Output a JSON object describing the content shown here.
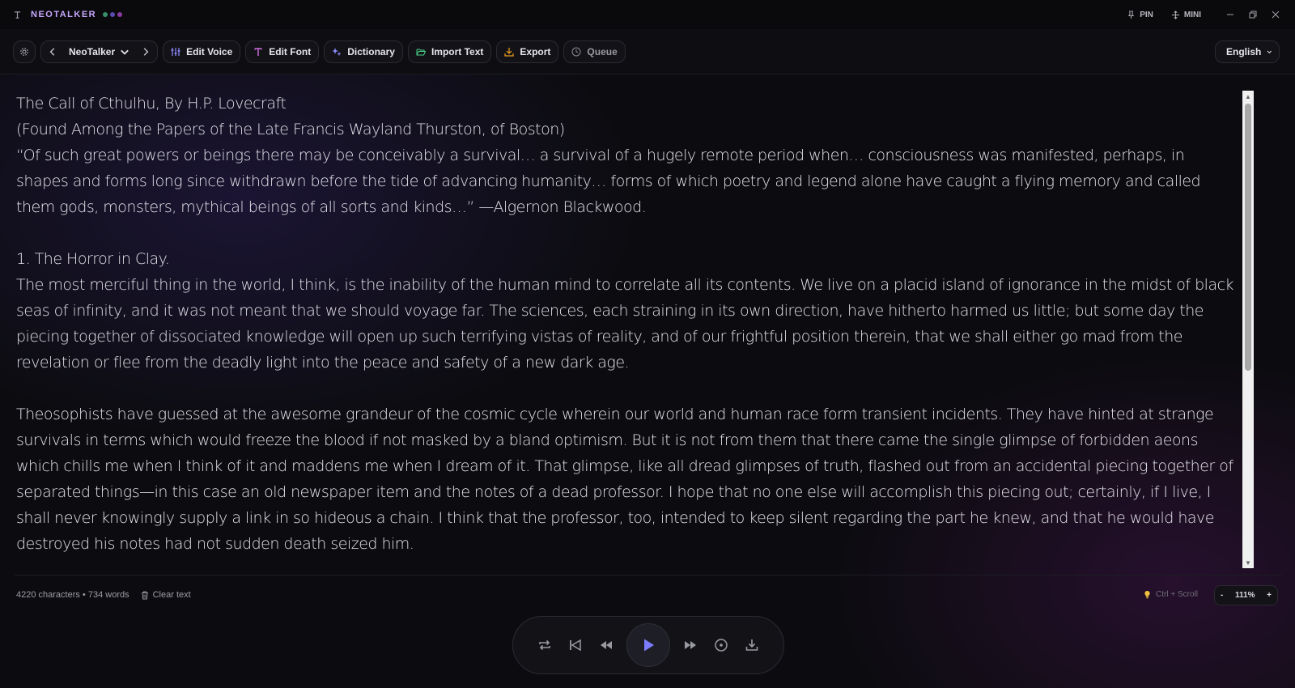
{
  "titlebar": {
    "app_name": "NEOTALKER",
    "pin_label": "PIN",
    "mini_label": "MINI",
    "dot_colors": [
      "#3a8f6a",
      "#5a4ab0",
      "#8a3aa0"
    ],
    "accent": "#c9a8ff"
  },
  "toolbar": {
    "voice_name": "NeoTalker",
    "edit_voice": "Edit Voice",
    "edit_font": "Edit Font",
    "dictionary": "Dictionary",
    "import_text": "Import Text",
    "export": "Export",
    "queue": "Queue",
    "language": "English",
    "icon_colors": {
      "edit_voice": "#8f8cff",
      "edit_font": "#d070e0",
      "dictionary": "#8f8cff",
      "import_text": "#4ad08a",
      "export": "#f0a020"
    }
  },
  "document": {
    "paragraphs": [
      "The Call of Cthulhu, By H.P. Lovecraft",
      "(Found Among the Papers of the Late Francis Wayland Thurston, of Boston)",
      "“Of such great powers or beings there may be conceivably a survival… a survival of a hugely remote period when… consciousness was manifested, perhaps, in shapes and forms long since withdrawn before the tide of advancing humanity… forms of which poetry and legend alone have caught a flying memory and called them gods, monsters, mythical beings of all sorts and kinds…” —Algernon Blackwood.",
      "",
      "1. The Horror in Clay.",
      "The most merciful thing in the world, I think, is the inability of the human mind to correlate all its contents. We live on a placid island of ignorance in the midst of black seas of infinity, and it was not meant that we should voyage far. The sciences, each straining in its own direction, have hitherto harmed us little; but some day the piecing together of dissociated knowledge will open up such terrifying vistas of reality, and of our frightful position therein, that we shall either go mad from the revelation or flee from the deadly light into the peace and safety of a new dark age.",
      "",
      "Theosophists have guessed at the awesome grandeur of the cosmic cycle wherein our world and human race form transient incidents. They have hinted at strange survivals in terms which would freeze the blood if not masked by a bland optimism. But it is not from them that there came the single glimpse of forbidden aeons which chills me when I think of it and maddens me when I dream of it. That glimpse, like all dread glimpses of truth, flashed out from an accidental piecing together of separated things—in this case an old newspaper item and the notes of a dead professor. I hope that no one else will accomplish this piecing out; certainly, if I live, I shall never knowingly supply a link in so hideous a chain. I think that the professor, too, intended to keep silent regarding the part he knew, and that he would have destroyed his notes had not sudden death seized him."
    ]
  },
  "status": {
    "counts": "4220 characters • 734 words",
    "clear_text": "Clear text",
    "zoom_hint": "Ctrl + Scroll",
    "zoom_minus": "-",
    "zoom_value": "111%",
    "zoom_plus": "+"
  },
  "player": {
    "play_color": "#7c7cff",
    "icons": [
      "repeat-icon",
      "skip-back-icon",
      "rewind-icon",
      "play-icon",
      "fast-forward-icon",
      "record-icon",
      "download-icon"
    ]
  }
}
